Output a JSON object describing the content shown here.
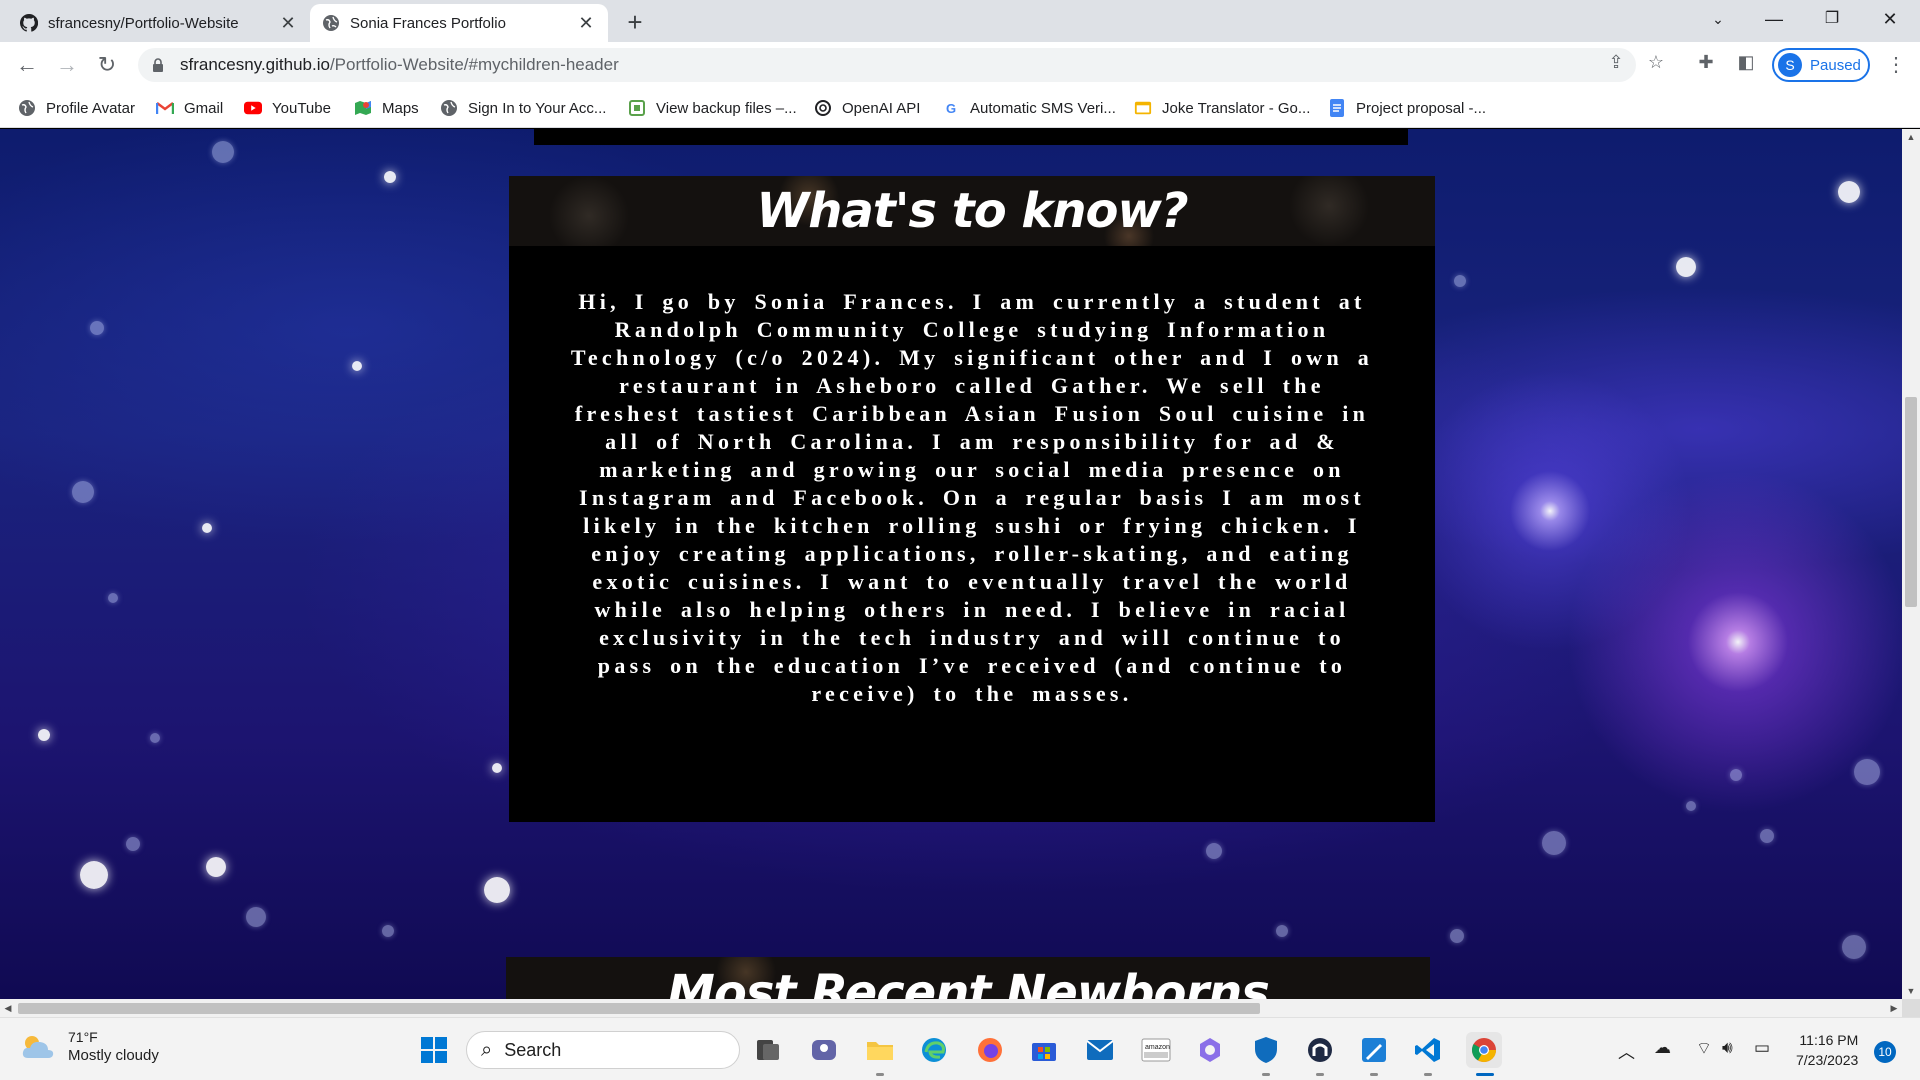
{
  "browser": {
    "tabs": [
      {
        "title": "sfrancesny/Portfolio-Website",
        "icon": "github-icon",
        "active": false
      },
      {
        "title": "Sonia Frances Portfolio",
        "icon": "globe-icon",
        "active": true
      }
    ],
    "new_tab_label": "+",
    "address": {
      "host": "sfrancesny.github.io",
      "path": "/Portfolio-Website/#mychildren-header"
    },
    "profile": {
      "initial": "S",
      "status": "Paused"
    },
    "bookmarks": [
      {
        "label": "Profile Avatar",
        "icon": "globe-icon"
      },
      {
        "label": "Gmail",
        "icon": "gmail-icon"
      },
      {
        "label": "YouTube",
        "icon": "youtube-icon"
      },
      {
        "label": "Maps",
        "icon": "maps-icon"
      },
      {
        "label": "Sign In to Your Acc...",
        "icon": "globe-icon"
      },
      {
        "label": "View backup files –...",
        "icon": "backup-icon"
      },
      {
        "label": "OpenAI API",
        "icon": "openai-icon"
      },
      {
        "label": "Automatic SMS Veri...",
        "icon": "google-icon"
      },
      {
        "label": "Joke Translator - Go...",
        "icon": "folder-icon"
      },
      {
        "label": "Project proposal -...",
        "icon": "docs-icon"
      }
    ]
  },
  "page": {
    "about_title": "What's to know?",
    "about_text": "Hi, I go by Sonia Frances. I am currently a student at Randolph Community College studying Information Technology (c/o 2024). My significant other and I own a restaurant in Asheboro called Gather. We sell the freshest tastiest Caribbean Asian Fusion Soul cuisine in all of North Carolina. I am responsibility for ad & marketing and growing our social media presence on Instagram and Facebook. On a regular basis I am most likely in the kitchen rolling sushi or frying chicken. I enjoy creating applications, roller-skating, and eating exotic cuisines. I want to eventually travel the world while also helping others in need. I believe in racial exclusivity in the tech industry and will continue to pass on the education I’ve received (and continue to receive) to the masses.",
    "next_section_title": "Most Recent Newborns"
  },
  "taskbar": {
    "weather": {
      "temp": "71°F",
      "condition": "Mostly cloudy"
    },
    "search_label": "Search",
    "apps": [
      "task-view-icon",
      "teams-icon",
      "file-explorer-icon",
      "edge-icon",
      "firefox-icon",
      "store-icon",
      "mail-icon",
      "amazon-icon",
      "copilot-icon",
      "defender-icon",
      "vpn-icon",
      "paint-icon",
      "vscode-icon",
      "chrome-icon"
    ],
    "clock": {
      "time": "11:16 PM",
      "date": "7/23/2023"
    },
    "notifications": "10"
  },
  "colors": {
    "chrome_frame": "#dee1e6",
    "accent": "#1a73e8",
    "page_card": "#000000",
    "space_bg": "#1a237e"
  }
}
